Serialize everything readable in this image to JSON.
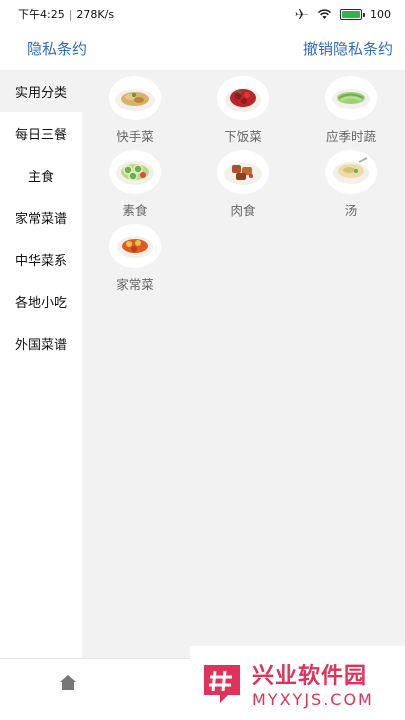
{
  "status_bar": {
    "time": "下午4:25",
    "speed": "278K/s",
    "battery": "100"
  },
  "header": {
    "privacy_label": "隐私条约",
    "revoke_label": "撤销隐私条约"
  },
  "sidebar": {
    "items": [
      {
        "label": "实用分类"
      },
      {
        "label": "每日三餐"
      },
      {
        "label": "主食"
      },
      {
        "label": "家常菜谱"
      },
      {
        "label": "中华菜系"
      },
      {
        "label": "各地小吃"
      },
      {
        "label": "外国菜谱"
      }
    ]
  },
  "categories": {
    "items": [
      {
        "label": "快手菜",
        "icon": "dish-stirfry-icon",
        "color": "#c9a35a"
      },
      {
        "label": "下饭菜",
        "icon": "dish-spicy-icon",
        "color": "#b8262a"
      },
      {
        "label": "应季时蔬",
        "icon": "dish-vegetable-icon",
        "color": "#8cc76a"
      },
      {
        "label": "素食",
        "icon": "dish-cucumber-icon",
        "color": "#78b84e"
      },
      {
        "label": "肉食",
        "icon": "dish-meat-icon",
        "color": "#a8512a"
      },
      {
        "label": "汤",
        "icon": "dish-soup-icon",
        "color": "#e8d9a8"
      },
      {
        "label": "家常菜",
        "icon": "dish-homestyle-icon",
        "color": "#d8481f"
      }
    ]
  },
  "watermark": {
    "cn": "兴业软件园",
    "en": "MYXYJS.COM"
  },
  "colors": {
    "link": "#2e6bc6",
    "accent": "#e0325a"
  }
}
